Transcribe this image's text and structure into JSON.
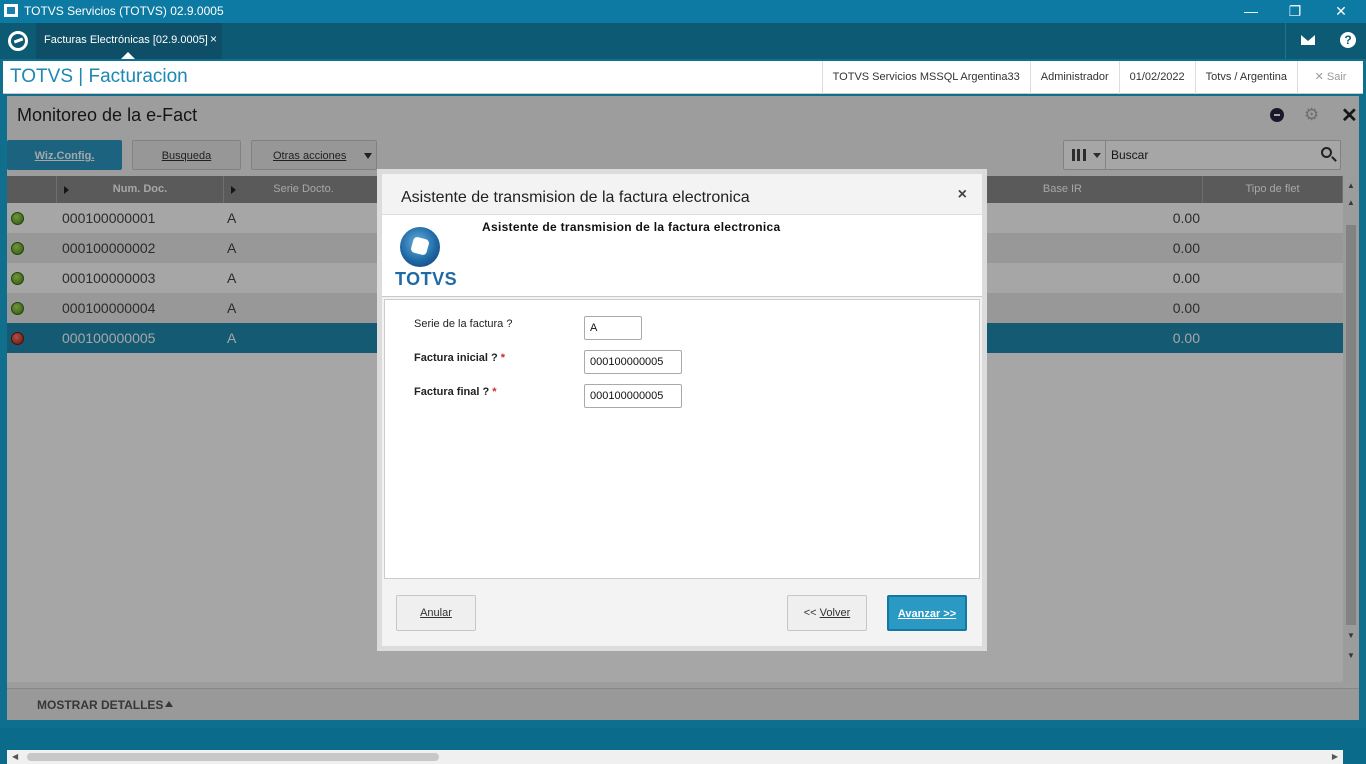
{
  "window": {
    "title": "TOTVS Servicios (TOTVS) 02.9.0005",
    "minimize": "—",
    "restore": "❐",
    "close": "✕"
  },
  "tabbar": {
    "active_tab": "Facturas Electrónicas [02.9.0005]",
    "tab_close": "×",
    "help": "?"
  },
  "header": {
    "app_title": "TOTVS | Facturacion",
    "environment": "TOTVS Servicios MSSQL Argentina33",
    "user": "Administrador",
    "date": "01/02/2022",
    "company": "Totvs / Argentina",
    "exit_label": "Sair",
    "exit_icon": "✕"
  },
  "page": {
    "title": "Monitoreo de la e-Fact",
    "settings_icon": "⚙",
    "close_icon": "✕"
  },
  "toolbar": {
    "wiz_config": "Wiz.Config.",
    "busqueda": "Busqueda",
    "otras_acciones": "Otras acciones",
    "search_placeholder": "Buscar"
  },
  "grid": {
    "columns": {
      "num_doc": "Num. Doc.",
      "serie": "Serie Docto.",
      "base_ir": "Base IR",
      "tipo_flet": "Tipo de flet"
    },
    "rows": [
      {
        "status": "green",
        "num": "000100000001",
        "serie": "A",
        "base_ir": "0.00"
      },
      {
        "status": "green",
        "num": "000100000002",
        "serie": "A",
        "base_ir": "0.00"
      },
      {
        "status": "green",
        "num": "000100000003",
        "serie": "A",
        "base_ir": "0.00"
      },
      {
        "status": "green",
        "num": "000100000004",
        "serie": "A",
        "base_ir": "0.00"
      },
      {
        "status": "red",
        "num": "000100000005",
        "serie": "A",
        "base_ir": "0.00"
      }
    ]
  },
  "footer": {
    "show_details": "MOSTRAR DETALLES"
  },
  "dialog": {
    "title": "Asistente de transmision de la factura electronica",
    "close": "×",
    "banner_title": "Asistente de transmision de la factura electronica",
    "logo_text": "TOTVS",
    "fields": {
      "serie_label": "Serie de la factura ?",
      "serie_value": "A",
      "inicial_label": "Factura inicial ?",
      "inicial_value": "000100000005",
      "final_label": "Factura final ?",
      "final_value": "000100000005",
      "required_mark": "*"
    },
    "buttons": {
      "anular": "Anular",
      "volver_prefix": "<< ",
      "volver": "Volver",
      "avanzar": "Avanzar >>"
    }
  }
}
